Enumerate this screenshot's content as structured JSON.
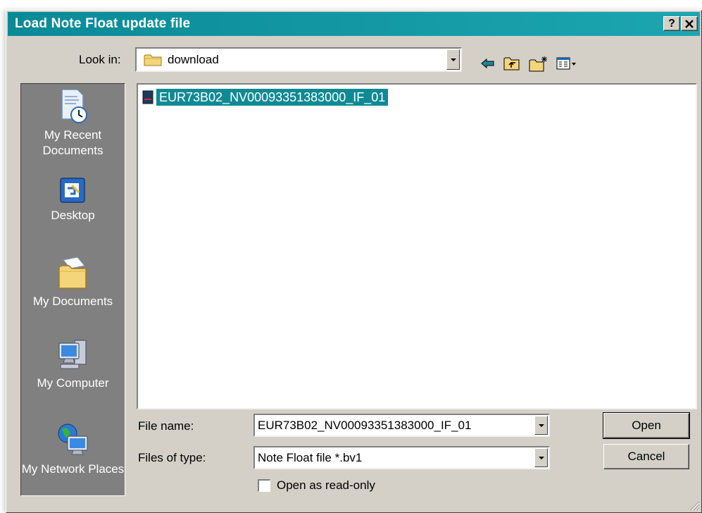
{
  "window": {
    "title": "Load Note Float update file",
    "help_label": "?",
    "close_label": "✕"
  },
  "lookin": {
    "label": "Look in:",
    "value": "download"
  },
  "toolbar": {
    "icons": [
      "back-icon",
      "up-folder-icon",
      "new-folder-icon",
      "view-menu-icon"
    ]
  },
  "places": [
    {
      "label": "My Recent Documents",
      "icon": "recent-documents-icon"
    },
    {
      "label": "Desktop",
      "icon": "desktop-icon"
    },
    {
      "label": "My Documents",
      "icon": "my-documents-icon"
    },
    {
      "label": "My Computer",
      "icon": "my-computer-icon"
    },
    {
      "label": "My Network Places",
      "icon": "network-places-icon"
    }
  ],
  "files": [
    {
      "name": "EUR73B02_NV00093351383000_IF_01",
      "selected": true
    }
  ],
  "filename": {
    "label": "File name:",
    "value": "EUR73B02_NV00093351383000_IF_01"
  },
  "filetype": {
    "label": "Files of type:",
    "value": "Note Float file *.bv1"
  },
  "buttons": {
    "open": "Open",
    "cancel": "Cancel"
  },
  "readonly": {
    "label": "Open as read-only",
    "checked": false
  },
  "colors": {
    "titlebar": "#0e8a94",
    "selection": "#0e8a94",
    "face": "#d4d0c8",
    "places_bg": "#808080"
  }
}
